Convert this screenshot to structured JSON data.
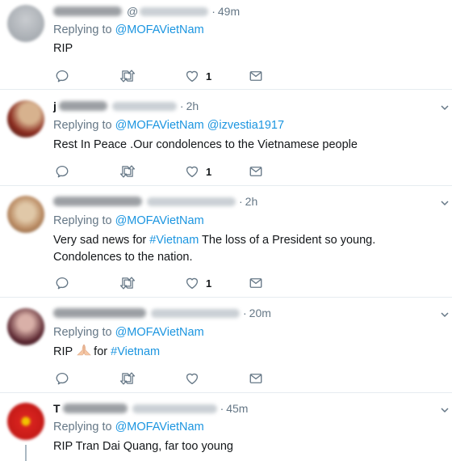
{
  "tweets": [
    {
      "name_text": "",
      "handle_text": "@",
      "time": "49m",
      "reply_prefix": "Replying to",
      "mentions": [
        "@MOFAVietNam"
      ],
      "body_parts": [
        {
          "t": "RIP",
          "tag": false
        }
      ],
      "like_count": "1",
      "avatar_colors": [
        "#c9ccd0",
        "#9aa0a6"
      ]
    },
    {
      "name_text": "j",
      "handle_text": "",
      "time": "2h",
      "reply_prefix": "Replying to",
      "mentions": [
        "@MOFAVietNam",
        "@izvestia1917"
      ],
      "body_parts": [
        {
          "t": "Rest In Peace .Our condolences to the Vietnamese people",
          "tag": false
        }
      ],
      "like_count": "1",
      "avatar_colors": [
        "#8a2b1f",
        "#d7b28e"
      ]
    },
    {
      "name_text": "",
      "handle_text": "",
      "time": "2h",
      "reply_prefix": "Replying to",
      "mentions": [
        "@MOFAVietNam"
      ],
      "body_parts": [
        {
          "t": "Very sad news for ",
          "tag": false
        },
        {
          "t": "#Vietnam",
          "tag": true
        },
        {
          "t": " The loss of a President so young. Condolences to the nation.",
          "tag": false
        }
      ],
      "like_count": "1",
      "avatar_colors": [
        "#b98a62",
        "#e0c8a8"
      ]
    },
    {
      "name_text": "",
      "handle_text": "",
      "time": "20m",
      "reply_prefix": "Replying to",
      "mentions": [
        "@MOFAVietNam"
      ],
      "body_parts": [
        {
          "t": "RIP",
          "tag": false
        },
        {
          "t": "🙏",
          "tag": false,
          "emoji": true
        },
        {
          "t": "for ",
          "tag": false
        },
        {
          "t": "#Vietnam",
          "tag": true
        }
      ],
      "like_count": "",
      "avatar_colors": [
        "#5a2630",
        "#d9b0a8"
      ]
    },
    {
      "name_text": "T",
      "handle_text": "",
      "time": "45m",
      "reply_prefix": "Replying to",
      "mentions": [
        "@MOFAVietNam"
      ],
      "body_parts": [
        {
          "t": "RIP Tran Dai Quang, far too young",
          "tag": false
        }
      ],
      "like_count": "",
      "avatar_colors": [
        "#d9231f",
        "#f2c400"
      ]
    }
  ],
  "colors": {
    "accent": "#1b95e0",
    "muted": "#657786",
    "text": "#14171a"
  },
  "icons": [
    "reply-icon",
    "retweet-icon",
    "like-icon",
    "dm-icon",
    "chevron-down-icon"
  ]
}
